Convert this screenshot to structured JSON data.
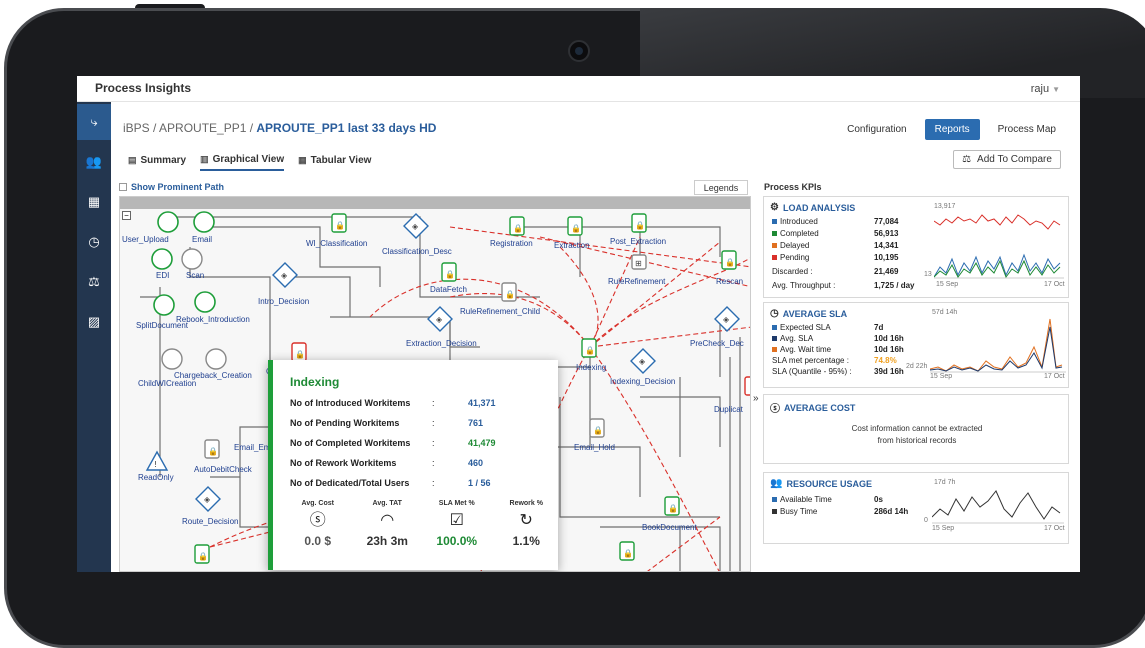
{
  "app": {
    "title": "Process Insights",
    "user": "raju"
  },
  "breadcrumb": {
    "root": "iBPS / APROUTE_PP1 / ",
    "current": "APROUTE_PP1 last 33 days HD"
  },
  "top_buttons": {
    "configuration": "Configuration",
    "reports": "Reports",
    "process_map": "Process Map"
  },
  "tabs": [
    {
      "label": "Summary",
      "icon": "summary-icon"
    },
    {
      "label": "Graphical View",
      "icon": "bar-chart-icon"
    },
    {
      "label": "Tabular View",
      "icon": "table-icon"
    }
  ],
  "add_compare": "Add To Compare",
  "show_prominent": "Show Prominent Path",
  "legends": "Legends",
  "nodes": {
    "user_upload": "User_Upload",
    "email": "Email",
    "edi": "EDI",
    "scan": "Scan",
    "wi_classification": "WI_Classification",
    "classification_desc": "Classification_Desc",
    "registration": "Registration",
    "extraction": "Extraction",
    "post_extraction": "Post_Extraction",
    "intro_decision": "Intro_Decision",
    "datafetch": "DataFetch",
    "rulerefinement": "RuleRefinement",
    "rescan": "Rescan",
    "splitdocument": "SplitDocument",
    "rebook_introduction": "Rebook_Introduction",
    "rulerefinement_child": "RuleRefinement_Child",
    "extraction_decision": "Extraction_Decision",
    "precheck_dec": "PreCheck_Dec",
    "indexing": "Indexing",
    "indexing_decision": "Indexing_Decision",
    "chargeback_creation": "Chargeback_Creation",
    "childwicreation": "ChildWICreation",
    "duplicat": "Duplicat",
    "email_em": "Email_Em",
    "email_hold": "Email_Hold",
    "readonly": "ReadOnly",
    "autodebitcheck": "AutoDebitCheck",
    "route_decision": "Route_Decision",
    "bookdocument": "BookDocument",
    "c_trunc": "C"
  },
  "popup": {
    "title": "Indexing",
    "rows": [
      {
        "label": "No of Introduced Workitems",
        "value": "41,371"
      },
      {
        "label": "No of Pending Workitems",
        "value": "761"
      },
      {
        "label": "No of Completed Workitems",
        "value": "41,479"
      },
      {
        "label": "No of Rework Workitems",
        "value": "460"
      },
      {
        "label": "No of Dedicated/Total Users",
        "value": "1 / 56"
      }
    ],
    "metrics": [
      {
        "label": "Avg. Cost",
        "icon": "dollar-icon",
        "value": "0.0 $"
      },
      {
        "label": "Avg. TAT",
        "icon": "gauge-icon",
        "value": "23h 3m"
      },
      {
        "label": "SLA Met %",
        "icon": "checkbox-icon",
        "value": "100.0%"
      },
      {
        "label": "Rework %",
        "icon": "rework-icon",
        "value": "1.1%"
      }
    ]
  },
  "kpi": {
    "title": "Process KPIs",
    "load": {
      "title": "LOAD ANALYSIS",
      "rows": [
        {
          "label": "Introduced",
          "value": "77,084",
          "color": "#2b6cb0"
        },
        {
          "label": "Completed",
          "value": "56,913",
          "color": "#1e8a35"
        },
        {
          "label": "Delayed",
          "value": "14,341",
          "color": "#e07020"
        },
        {
          "label": "Pending",
          "value": "10,195",
          "color": "#d9302a"
        },
        {
          "label": "Discarded :",
          "value": "21,469"
        },
        {
          "label": "Avg. Throughput :",
          "value": "1,725 / day"
        }
      ],
      "y_max": "13,917",
      "y_min": "13",
      "x_start": "15 Sep",
      "x_end": "17 Oct"
    },
    "sla": {
      "title": "AVERAGE SLA",
      "rows": [
        {
          "label": "Expected SLA",
          "value": "7d",
          "color": "#2b6cb0"
        },
        {
          "label": "Avg. SLA",
          "value": "10d 16h",
          "color": "#1e3a6b"
        },
        {
          "label": "Avg. Wait time",
          "value": "10d 16h",
          "color": "#e07020"
        },
        {
          "label": "SLA met percentage :",
          "value": "74.8%"
        },
        {
          "label": "SLA (Quantile - 95%) :",
          "value": "39d 16h"
        }
      ],
      "y_max": "57d 14h",
      "y_min": "2d 22h",
      "x_start": "15 Sep",
      "x_end": "17 Oct"
    },
    "cost": {
      "title": "AVERAGE COST",
      "msg1": "Cost information cannot be extracted",
      "msg2": "from historical records"
    },
    "resource": {
      "title": "RESOURCE USAGE",
      "rows": [
        {
          "label": "Available Time",
          "value": "0s",
          "color": "#2b6cb0"
        },
        {
          "label": "Busy Time",
          "value": "286d 14h",
          "color": "#333333"
        }
      ],
      "y_max": "17d 7h",
      "y_min": "0",
      "x_start": "15 Sep",
      "x_end": "17 Oct"
    }
  }
}
